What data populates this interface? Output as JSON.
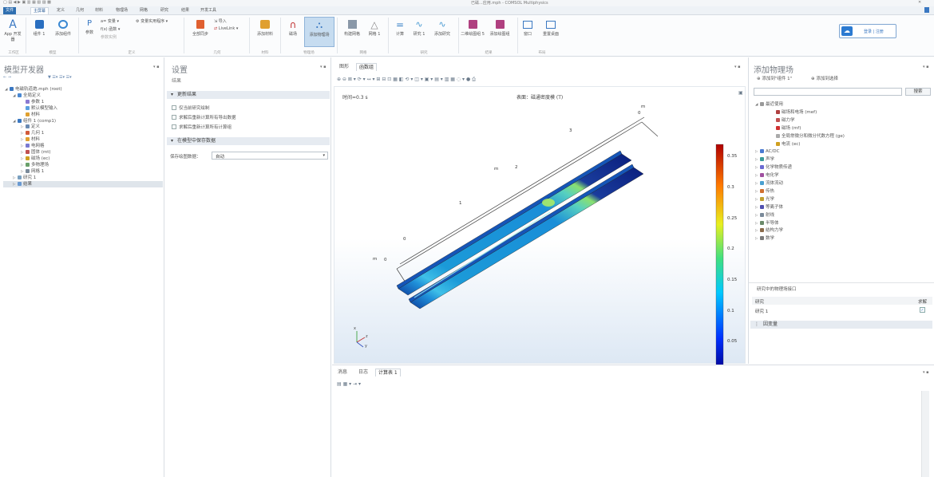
{
  "window": {
    "title": "已磁...应用.mph - COMSOL Multiphysics"
  },
  "menu": {
    "tabs": [
      "文件",
      "主屏幕",
      "定义",
      "几何",
      "材料",
      "物理场",
      "网格",
      "研究",
      "结果",
      "开发工具"
    ],
    "active_index": 1
  },
  "ribbon": {
    "app_label": "App 开发器",
    "app_sub": "开发器",
    "components_label": "组件 1",
    "add_component_label": "添加组件",
    "params_label": "参数",
    "variables_label": "变量",
    "functions_label": "函数",
    "param_case_label": "参数实例",
    "var_util_label": "变量实用程序",
    "all_sync_label": "全部同步",
    "import_label": "导入",
    "livelink_label": "LiveLink",
    "add_material_label": "添加材料",
    "magnetic_label": "磁场",
    "add_physics_label": "添加物理场",
    "build_mesh_label": "构建网格",
    "mesh_label": "网格 1",
    "compute_label": "计算",
    "study_label": "研究 1",
    "add_study_label": "添加研究",
    "plot_label": "二维绘图组 5",
    "add_plot_label": "添加绘图组",
    "windows_label": "窗口",
    "reset_desktop_label": "重置桌面",
    "groups": [
      "工作区",
      "模型",
      "定义",
      "几何",
      "材料",
      "物理场",
      "网格",
      "研究",
      "结果",
      "布局"
    ],
    "cloud_label": "登录 | 注册"
  },
  "model_builder": {
    "title": "模型开发器",
    "tree": [
      {
        "label": "电磁轨道炮.mph (root)",
        "indent": 0,
        "toggle": "◢",
        "color": "#3a78c2"
      },
      {
        "label": "全局定义",
        "indent": 1,
        "toggle": "◢",
        "color": "#4a88d2"
      },
      {
        "label": "参数 1",
        "indent": 2,
        "toggle": "",
        "color": "#8a7ad2"
      },
      {
        "label": "默认模型输入",
        "indent": 2,
        "toggle": "",
        "color": "#5aa0e0"
      },
      {
        "label": "材料",
        "indent": 2,
        "toggle": "",
        "color": "#e0a030"
      },
      {
        "label": "组件 1 (comp1)",
        "indent": 1,
        "toggle": "◢",
        "color": "#3a78c2"
      },
      {
        "label": "定义",
        "indent": 2,
        "toggle": "▷",
        "color": "#6a8ab2"
      },
      {
        "label": "几何 1",
        "indent": 2,
        "toggle": "▷",
        "color": "#d25a3a"
      },
      {
        "label": "材料",
        "indent": 2,
        "toggle": "▷",
        "color": "#e0a030"
      },
      {
        "label": "电网格",
        "indent": 2,
        "toggle": "▷",
        "color": "#7a7ad2"
      },
      {
        "label": "固体 (mt)",
        "indent": 2,
        "toggle": "▷",
        "color": "#c05050"
      },
      {
        "label": "磁场 (ec)",
        "indent": 2,
        "toggle": "▷",
        "color": "#d0a020"
      },
      {
        "label": "多物理场",
        "indent": 2,
        "toggle": "▷",
        "color": "#6aa06a"
      },
      {
        "label": "网格 1",
        "indent": 2,
        "toggle": "▷",
        "color": "#7a8a9a"
      },
      {
        "label": "研究 1",
        "indent": 1,
        "toggle": "▷",
        "color": "#7aa0c0"
      },
      {
        "label": "结果",
        "indent": 1,
        "toggle": "▷",
        "color": "#6a9ad2",
        "selected": true
      }
    ]
  },
  "settings": {
    "title": "设置",
    "subtitle": "结果",
    "section1": "更新结果",
    "checkbox1": "仅当前研究绘制",
    "checkbox2": "求解后重新计算所有导出数据",
    "checkbox3": "求解后重新计算所有计算组",
    "section2": "在模型中保存数据",
    "save_label": "保存绘图数据：",
    "save_value": "自动"
  },
  "graphics": {
    "tabs": [
      "图形",
      "函数组"
    ],
    "active_tab": 1,
    "left_info": "时间=0.3 s",
    "center_info": "表面：磁通密度模 (T)",
    "axis_labels": {
      "m_top": "m",
      "t3": "3",
      "t2": "2",
      "m_mid": "m",
      "t1": "1",
      "t0": "0",
      "m_left": "m",
      "t0b": "0",
      "t0c": "0"
    },
    "colorbar": {
      "min": 0,
      "max": 0.37,
      "ticks": [
        "0.35",
        "0.3",
        "0.25",
        "0.2",
        "0.15",
        "0.1",
        "0.05"
      ]
    },
    "axes_x": "x",
    "axes_y": "y",
    "axes_z": "z"
  },
  "bottom": {
    "tabs": [
      "消息",
      "日志",
      "计算表 1"
    ],
    "active_tab": 2
  },
  "add_physics": {
    "title": "添加物理场",
    "add_to_label": "添加到\"组件 1\"",
    "add_to_selection": "添加到选择",
    "search_button": "搜索",
    "items": [
      {
        "label": "最近使用",
        "indent": 0,
        "toggle": "◢",
        "color": "#999"
      },
      {
        "label": "磁场和电场 (mef)",
        "indent": 2,
        "toggle": "",
        "color": "#b04040"
      },
      {
        "label": "磁力学",
        "indent": 2,
        "toggle": "",
        "color": "#c05050"
      },
      {
        "label": "磁场 (mf)",
        "indent": 2,
        "toggle": "",
        "color": "#d03030"
      },
      {
        "label": "全局常微分和微分代数方程 (ge)",
        "indent": 2,
        "toggle": "",
        "color": "#aaa"
      },
      {
        "label": "电流 (ec)",
        "indent": 2,
        "toggle": "",
        "color": "#d0a020"
      },
      {
        "label": "AC/DC",
        "indent": 0,
        "toggle": "▷",
        "color": "#4a7ad2"
      },
      {
        "label": "声学",
        "indent": 0,
        "toggle": "▷",
        "color": "#3a9a9a"
      },
      {
        "label": "化学物质传递",
        "indent": 0,
        "toggle": "▷",
        "color": "#6a6ad2"
      },
      {
        "label": "电化学",
        "indent": 0,
        "toggle": "▷",
        "color": "#a050a0"
      },
      {
        "label": "流体流动",
        "indent": 0,
        "toggle": "▷",
        "color": "#4aa0d0"
      },
      {
        "label": "传热",
        "indent": 0,
        "toggle": "▷",
        "color": "#d07030"
      },
      {
        "label": "光学",
        "indent": 0,
        "toggle": "▷",
        "color": "#c0a030"
      },
      {
        "label": "等离子体",
        "indent": 0,
        "toggle": "▷",
        "color": "#5050b0"
      },
      {
        "label": "射线",
        "indent": 0,
        "toggle": "▷",
        "color": "#7a8a9a"
      },
      {
        "label": "半导体",
        "indent": 0,
        "toggle": "▷",
        "color": "#6a8a6a"
      },
      {
        "label": "结构力学",
        "indent": 0,
        "toggle": "▷",
        "color": "#8a6a4a"
      },
      {
        "label": "数学",
        "indent": 0,
        "toggle": "▷",
        "color": "#7a7a7a"
      }
    ],
    "study_interface_title": "研究中的物理场接口",
    "col_study": "研究",
    "col_solve": "求解",
    "study_row": "研究 1",
    "dependent_vars": "因变量"
  }
}
